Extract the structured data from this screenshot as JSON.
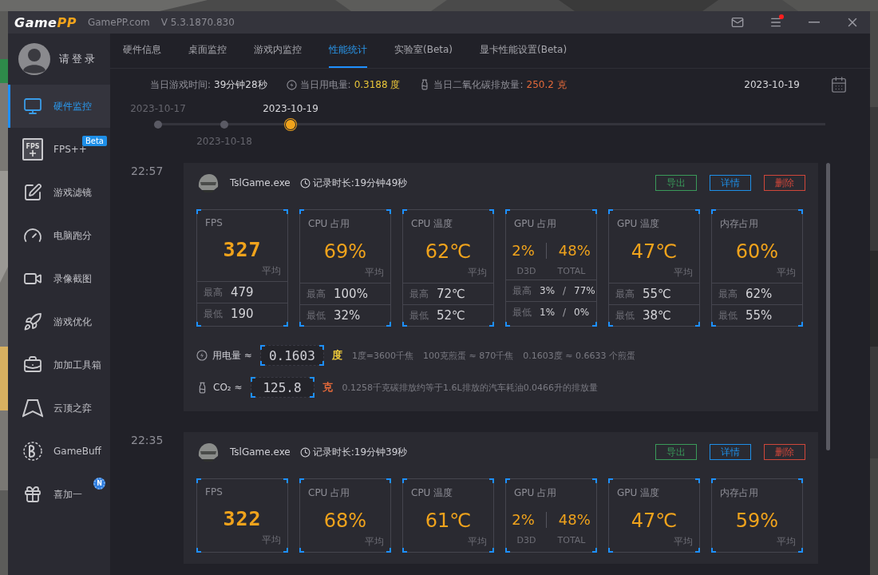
{
  "window": {
    "logo_a": "Game",
    "logo_b": "PP",
    "site": "GamePP.com",
    "version": "V 5.3.1870.830",
    "menu_notice": true
  },
  "sidebar": {
    "login": "请登录",
    "items": [
      {
        "label": "硬件监控",
        "selected": true
      },
      {
        "label": "FPS++",
        "selected": false,
        "icon_text": "FPS",
        "badge": {
          "kind": "tag",
          "text": "Beta"
        }
      },
      {
        "label": "游戏滤镜",
        "selected": false
      },
      {
        "label": "电脑跑分",
        "selected": false
      },
      {
        "label": "录像截图",
        "selected": false
      },
      {
        "label": "游戏优化",
        "selected": false
      },
      {
        "label": "加加工具箱",
        "selected": false
      },
      {
        "label": "云顶之弈",
        "selected": false
      },
      {
        "label": "GameBuff",
        "selected": false
      },
      {
        "label": "喜加一",
        "selected": false,
        "badge": {
          "kind": "star",
          "text": "N"
        }
      }
    ]
  },
  "tabs": [
    {
      "label": "硬件信息",
      "selected": false
    },
    {
      "label": "桌面监控",
      "selected": false
    },
    {
      "label": "游戏内监控",
      "selected": false
    },
    {
      "label": "性能统计",
      "selected": true
    },
    {
      "label": "实验室(Beta)",
      "selected": false
    },
    {
      "label": "显卡性能设置(Beta)",
      "selected": false
    }
  ],
  "summary": {
    "items": [
      {
        "kind": "time",
        "label": "当日游戏时间:",
        "value": "39分钟28秒",
        "color": "#d8d8dc"
      },
      {
        "kind": "power",
        "label": "当日用电量:",
        "value": "0.3188 度",
        "color": "#e8c53a"
      },
      {
        "kind": "co2",
        "label": "当日二氧化碳排放量:",
        "value": "250.2 克",
        "color": "#e3693a"
      }
    ],
    "date": "2023-10-19"
  },
  "timeline": [
    {
      "label": "2023-10-17",
      "selected": false
    },
    {
      "label": "2023-10-18",
      "selected": false
    },
    {
      "label": "2023-10-19",
      "selected": true
    }
  ],
  "sessions": [
    {
      "time": "22:57",
      "process": "TslGame.exe",
      "duration": "记录时长:19分钟49秒",
      "buttons": [
        {
          "label": "导出",
          "color": "#3a9a5a"
        },
        {
          "label": "详情",
          "color": "#1e8fe8"
        },
        {
          "label": "删除",
          "color": "#d0473a"
        }
      ],
      "metrics": [
        {
          "kind": "single",
          "title": "FPS",
          "value": "327",
          "digital": true,
          "note": "平均",
          "max_label": "最高",
          "max": "479",
          "min_label": "最低",
          "min": "190"
        },
        {
          "kind": "single",
          "title": "CPU 占用",
          "value": "69%",
          "digital": false,
          "note": "平均",
          "max_label": "最高",
          "max": "100%",
          "min_label": "最低",
          "min": "32%"
        },
        {
          "kind": "single",
          "title": "CPU 温度",
          "value": "62℃",
          "digital": false,
          "note": "平均",
          "max_label": "最高",
          "max": "72℃",
          "min_label": "最低",
          "min": "52℃"
        },
        {
          "kind": "dual",
          "title": "GPU 占用",
          "values": [
            "2%",
            "48%"
          ],
          "notes": [
            "D3D",
            "TOTAL"
          ],
          "separator": "/",
          "max_label": "最高",
          "max": [
            "3%",
            "77%"
          ],
          "min_label": "最低",
          "min": [
            "1%",
            "0%"
          ]
        },
        {
          "kind": "single",
          "title": "GPU 温度",
          "value": "47℃",
          "digital": false,
          "note": "平均",
          "max_label": "最高",
          "max": "55℃",
          "min_label": "最低",
          "min": "38℃"
        },
        {
          "kind": "single",
          "title": "内存占用",
          "value": "60%",
          "digital": false,
          "note": "平均",
          "max_label": "最高",
          "max": "62%",
          "min_label": "最低",
          "min": "55%"
        }
      ],
      "footer": [
        {
          "kind": "power",
          "label": "用电量 ≈",
          "reading": "0.1603",
          "unit": "度",
          "color": "#e8c53a",
          "notes": [
            "1度=3600千焦",
            "100克煎蛋 ≈ 870千焦",
            "0.1603度 ≈ 0.6633 个煎蛋"
          ]
        },
        {
          "kind": "co2",
          "label": "CO₂ ≈",
          "reading": "125.8",
          "unit": "克",
          "color": "#e3693a",
          "notes": [
            "0.1258千克碳排放约等于1.6L排放的汽车耗油0.0466升的排放量"
          ]
        }
      ]
    },
    {
      "time": "22:35",
      "process": "TslGame.exe",
      "duration": "记录时长:19分钟39秒",
      "buttons": [
        {
          "label": "导出",
          "color": "#3a9a5a"
        },
        {
          "label": "详情",
          "color": "#1e8fe8"
        },
        {
          "label": "删除",
          "color": "#d0473a"
        }
      ],
      "metrics": [
        {
          "kind": "single",
          "title": "FPS",
          "value": "322",
          "digital": true,
          "note": "平均"
        },
        {
          "kind": "single",
          "title": "CPU 占用",
          "value": "68%",
          "digital": false,
          "note": "平均"
        },
        {
          "kind": "single",
          "title": "CPU 温度",
          "value": "61℃",
          "digital": false,
          "note": "平均"
        },
        {
          "kind": "dual",
          "title": "GPU 占用",
          "values": [
            "2%",
            "48%"
          ],
          "notes": [
            "D3D",
            "TOTAL"
          ]
        },
        {
          "kind": "single",
          "title": "GPU 温度",
          "value": "47℃",
          "digital": false,
          "note": "平均"
        },
        {
          "kind": "single",
          "title": "内存占用",
          "value": "59%",
          "digital": false,
          "note": "平均"
        }
      ]
    }
  ]
}
